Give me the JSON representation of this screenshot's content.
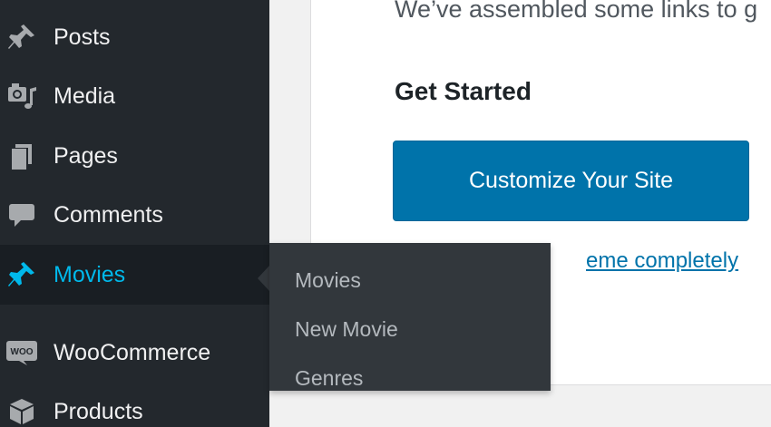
{
  "sidebar": {
    "items": [
      {
        "label": "Posts",
        "icon": "pin-icon"
      },
      {
        "label": "Media",
        "icon": "media-icon"
      },
      {
        "label": "Pages",
        "icon": "pages-icon"
      },
      {
        "label": "Comments",
        "icon": "comment-icon"
      },
      {
        "label": "Movies",
        "icon": "pin-icon",
        "active": true
      },
      {
        "label": "WooCommerce",
        "icon": "woo-icon"
      },
      {
        "label": "Products",
        "icon": "box-icon"
      }
    ],
    "woo_icon_text": "WOO"
  },
  "flyout": {
    "items": [
      "Movies",
      "New Movie",
      "Genres"
    ]
  },
  "main": {
    "intro_text": "We’ve assembled some links to g",
    "section_title": "Get Started",
    "primary_button": "Customize Your Site",
    "link_text": "eme completely"
  },
  "colors": {
    "sidebar_bg": "#23282d",
    "flyout_bg": "#32373c",
    "accent": "#00b9eb",
    "button_blue": "#0073aa"
  }
}
